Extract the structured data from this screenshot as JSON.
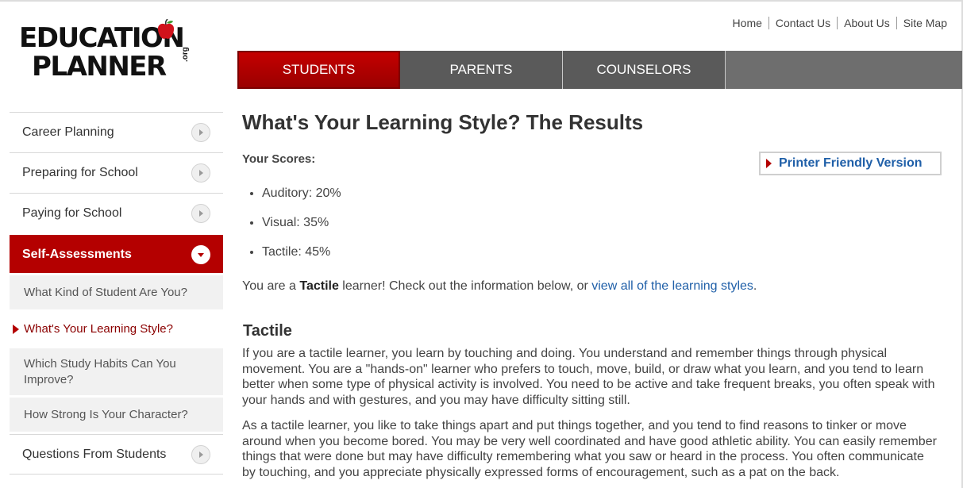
{
  "logo": {
    "line1": "EDUCATION",
    "line2": "PLANNER",
    "org": ".org"
  },
  "utility_nav": [
    "Home",
    "Contact Us",
    "About Us",
    "Site Map"
  ],
  "main_nav": {
    "tabs": [
      "STUDENTS",
      "PARENTS",
      "COUNSELORS"
    ],
    "active": "STUDENTS"
  },
  "sidebar": {
    "items": [
      {
        "label": "Career Planning"
      },
      {
        "label": "Preparing for School"
      },
      {
        "label": "Paying for School"
      },
      {
        "label": "Self-Assessments"
      },
      {
        "label": "Questions From Students"
      }
    ],
    "sub_items": [
      {
        "label": "What Kind of Student Are You?"
      },
      {
        "label": "What's Your Learning Style?"
      },
      {
        "label": "Which Study Habits Can You Improve?"
      },
      {
        "label": "How Strong Is Your Character?"
      }
    ]
  },
  "content": {
    "title": "What's Your Learning Style? The Results",
    "scores_label": "Your Scores:",
    "printer_label": "Printer Friendly Version",
    "scores": [
      "Auditory: 20%",
      "Visual: 35%",
      "Tactile: 45%"
    ],
    "summary_prefix": "You are a ",
    "summary_bold": "Tactile",
    "summary_mid": " learner! Check out the information below, or ",
    "summary_link": "view all of the learning styles",
    "summary_end": ".",
    "section_title": "Tactile",
    "paragraph1": "If you are a tactile learner, you learn by touching and doing. You understand and remember things through physical movement. You are a \"hands-on\" learner who prefers to touch, move, build, or draw what you learn, and you tend to learn better when some type of physical activity is involved. You need to be active and take frequent breaks, you often speak with your hands and with gestures, and you may have difficulty sitting still.",
    "paragraph2": "As a tactile learner, you like to take things apart and put things together, and you tend to find reasons to tinker or move around when you become bored. You may be very well coordinated and have good athletic ability. You can easily remember things that were done but may have difficulty remembering what you saw or heard in the process. You often communicate by touching, and you appreciate physically expressed forms of encouragement, such as a pat on the back."
  },
  "colors": {
    "brand_red": "#b40000",
    "nav_gray": "#5a5a5a",
    "link_blue": "#1f5fa8"
  }
}
